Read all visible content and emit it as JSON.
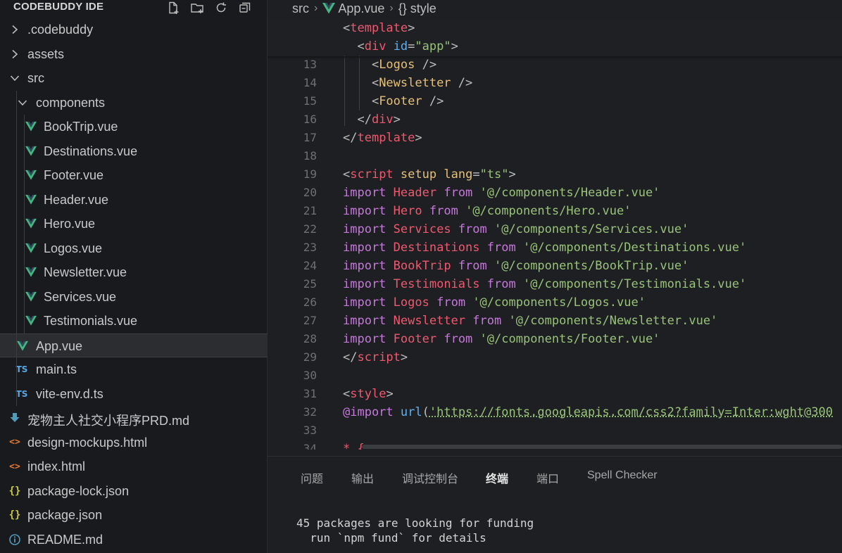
{
  "explorer": {
    "title": "CODEBUDDY IDE",
    "actions": [
      "new-file-icon",
      "new-folder-icon",
      "refresh-icon",
      "collapse-all-icon"
    ],
    "items": [
      {
        "label": ".codebuddy",
        "depth": 0,
        "kind": "folder",
        "open": false,
        "icon": "chevron-right-icon"
      },
      {
        "label": "assets",
        "depth": 0,
        "kind": "folder",
        "open": false,
        "icon": "chevron-right-icon"
      },
      {
        "label": "src",
        "depth": 0,
        "kind": "folder",
        "open": true,
        "icon": "chevron-down-icon"
      },
      {
        "label": "components",
        "depth": 1,
        "kind": "folder",
        "open": true,
        "icon": "chevron-down-icon"
      },
      {
        "label": "BookTrip.vue",
        "depth": 2,
        "kind": "vue",
        "icon": "vue-icon"
      },
      {
        "label": "Destinations.vue",
        "depth": 2,
        "kind": "vue",
        "icon": "vue-icon"
      },
      {
        "label": "Footer.vue",
        "depth": 2,
        "kind": "vue",
        "icon": "vue-icon"
      },
      {
        "label": "Header.vue",
        "depth": 2,
        "kind": "vue",
        "icon": "vue-icon"
      },
      {
        "label": "Hero.vue",
        "depth": 2,
        "kind": "vue",
        "icon": "vue-icon"
      },
      {
        "label": "Logos.vue",
        "depth": 2,
        "kind": "vue",
        "icon": "vue-icon"
      },
      {
        "label": "Newsletter.vue",
        "depth": 2,
        "kind": "vue",
        "icon": "vue-icon"
      },
      {
        "label": "Services.vue",
        "depth": 2,
        "kind": "vue",
        "icon": "vue-icon"
      },
      {
        "label": "Testimonials.vue",
        "depth": 2,
        "kind": "vue",
        "icon": "vue-icon"
      },
      {
        "label": "App.vue",
        "depth": 1,
        "kind": "vue",
        "icon": "vue-icon",
        "selected": true
      },
      {
        "label": "main.ts",
        "depth": 1,
        "kind": "ts",
        "icon": "typescript-icon",
        "icon_text": "TS"
      },
      {
        "label": "vite-env.d.ts",
        "depth": 1,
        "kind": "ts",
        "icon": "typescript-icon",
        "icon_text": "TS"
      },
      {
        "label": "宠物主人社交小程序PRD.md",
        "depth": 0,
        "kind": "md-down",
        "icon": "download-arrow-icon"
      },
      {
        "label": "design-mockups.html",
        "depth": 0,
        "kind": "html",
        "icon": "html-icon",
        "icon_text": "<>"
      },
      {
        "label": "index.html",
        "depth": 0,
        "kind": "html",
        "icon": "html-icon",
        "icon_text": "<>"
      },
      {
        "label": "package-lock.json",
        "depth": 0,
        "kind": "json",
        "icon": "json-icon",
        "icon_text": "{}"
      },
      {
        "label": "package.json",
        "depth": 0,
        "kind": "json",
        "icon": "json-icon",
        "icon_text": "{}"
      },
      {
        "label": "README.md",
        "depth": 0,
        "kind": "info",
        "icon": "info-icon"
      }
    ]
  },
  "breadcrumb": {
    "folder": "src",
    "file": "App.vue",
    "symbol": "{} style"
  },
  "editor": {
    "sticky_lines": [
      [
        [
          "<",
          "punc"
        ],
        [
          "template",
          "tagred"
        ],
        [
          ">",
          "punc"
        ]
      ],
      [
        [
          "  <",
          "punc"
        ],
        [
          "div",
          "tagred"
        ],
        [
          " ",
          ""
        ],
        [
          "id",
          "attr"
        ],
        [
          "=",
          "punc"
        ],
        [
          "\"app\"",
          "str"
        ],
        [
          ">",
          "punc"
        ]
      ]
    ],
    "lines": [
      {
        "n": "13",
        "tokens": [
          [
            "    <",
            "punc"
          ],
          [
            "Logos",
            "tag"
          ],
          [
            " />",
            "punc"
          ]
        ]
      },
      {
        "n": "14",
        "tokens": [
          [
            "    <",
            "punc"
          ],
          [
            "Newsletter",
            "tag"
          ],
          [
            " />",
            "punc"
          ]
        ]
      },
      {
        "n": "15",
        "tokens": [
          [
            "    <",
            "punc"
          ],
          [
            "Footer",
            "tag"
          ],
          [
            " />",
            "punc"
          ]
        ]
      },
      {
        "n": "16",
        "tokens": [
          [
            "  </",
            "punc"
          ],
          [
            "div",
            "tagred"
          ],
          [
            ">",
            "punc"
          ]
        ]
      },
      {
        "n": "17",
        "tokens": [
          [
            "</",
            "punc"
          ],
          [
            "template",
            "tagred"
          ],
          [
            ">",
            "punc"
          ]
        ]
      },
      {
        "n": "18",
        "tokens": []
      },
      {
        "n": "19",
        "tokens": [
          [
            "<",
            "punc"
          ],
          [
            "script",
            "tagred"
          ],
          [
            " ",
            ""
          ],
          [
            "setup",
            "tag"
          ],
          [
            " ",
            ""
          ],
          [
            "lang",
            "tag"
          ],
          [
            "=",
            "punc"
          ],
          [
            "\"ts\"",
            "str"
          ],
          [
            ">",
            "punc"
          ]
        ]
      },
      {
        "n": "20",
        "tokens": [
          [
            "import",
            "kw"
          ],
          [
            " ",
            ""
          ],
          [
            "Header",
            "id"
          ],
          [
            " ",
            ""
          ],
          [
            "from",
            "kw"
          ],
          [
            " ",
            ""
          ],
          [
            "'@/components/Header.vue'",
            "str"
          ]
        ]
      },
      {
        "n": "21",
        "tokens": [
          [
            "import",
            "kw"
          ],
          [
            " ",
            ""
          ],
          [
            "Hero",
            "id"
          ],
          [
            " ",
            ""
          ],
          [
            "from",
            "kw"
          ],
          [
            " ",
            ""
          ],
          [
            "'@/components/Hero.vue'",
            "str"
          ]
        ]
      },
      {
        "n": "22",
        "tokens": [
          [
            "import",
            "kw"
          ],
          [
            " ",
            ""
          ],
          [
            "Services",
            "id"
          ],
          [
            " ",
            ""
          ],
          [
            "from",
            "kw"
          ],
          [
            " ",
            ""
          ],
          [
            "'@/components/Services.vue'",
            "str"
          ]
        ]
      },
      {
        "n": "23",
        "tokens": [
          [
            "import",
            "kw"
          ],
          [
            " ",
            ""
          ],
          [
            "Destinations",
            "id"
          ],
          [
            " ",
            ""
          ],
          [
            "from",
            "kw"
          ],
          [
            " ",
            ""
          ],
          [
            "'@/components/Destinations.vue'",
            "str"
          ]
        ]
      },
      {
        "n": "24",
        "tokens": [
          [
            "import",
            "kw"
          ],
          [
            " ",
            ""
          ],
          [
            "BookTrip",
            "id"
          ],
          [
            " ",
            ""
          ],
          [
            "from",
            "kw"
          ],
          [
            " ",
            ""
          ],
          [
            "'@/components/BookTrip.vue'",
            "str"
          ]
        ]
      },
      {
        "n": "25",
        "tokens": [
          [
            "import",
            "kw"
          ],
          [
            " ",
            ""
          ],
          [
            "Testimonials",
            "id"
          ],
          [
            " ",
            ""
          ],
          [
            "from",
            "kw"
          ],
          [
            " ",
            ""
          ],
          [
            "'@/components/Testimonials.vue'",
            "str"
          ]
        ]
      },
      {
        "n": "26",
        "tokens": [
          [
            "import",
            "kw"
          ],
          [
            " ",
            ""
          ],
          [
            "Logos",
            "id"
          ],
          [
            " ",
            ""
          ],
          [
            "from",
            "kw"
          ],
          [
            " ",
            ""
          ],
          [
            "'@/components/Logos.vue'",
            "str"
          ]
        ]
      },
      {
        "n": "27",
        "tokens": [
          [
            "import",
            "kw"
          ],
          [
            " ",
            ""
          ],
          [
            "Newsletter",
            "id"
          ],
          [
            " ",
            ""
          ],
          [
            "from",
            "kw"
          ],
          [
            " ",
            ""
          ],
          [
            "'@/components/Newsletter.vue'",
            "str"
          ]
        ]
      },
      {
        "n": "28",
        "tokens": [
          [
            "import",
            "kw"
          ],
          [
            " ",
            ""
          ],
          [
            "Footer",
            "id"
          ],
          [
            " ",
            ""
          ],
          [
            "from",
            "kw"
          ],
          [
            " ",
            ""
          ],
          [
            "'@/components/Footer.vue'",
            "str"
          ]
        ]
      },
      {
        "n": "29",
        "tokens": [
          [
            "</",
            "punc"
          ],
          [
            "script",
            "tagred"
          ],
          [
            ">",
            "punc"
          ]
        ]
      },
      {
        "n": "30",
        "tokens": []
      },
      {
        "n": "31",
        "tokens": [
          [
            "<",
            "punc"
          ],
          [
            "style",
            "tagred"
          ],
          [
            ">",
            "punc"
          ]
        ]
      },
      {
        "n": "32",
        "tokens": [
          [
            "@import",
            "kw"
          ],
          [
            " ",
            ""
          ],
          [
            "url",
            "fn"
          ],
          [
            "(",
            "punc"
          ],
          [
            "'https://fonts.googleapis.com/css2?family=Inter:wght@300",
            "url"
          ]
        ]
      },
      {
        "n": "33",
        "tokens": []
      },
      {
        "n": "34",
        "tokens": [
          [
            "* {",
            "tagred"
          ]
        ]
      }
    ]
  },
  "panel": {
    "tabs": [
      {
        "label": "问题",
        "active": false
      },
      {
        "label": "输出",
        "active": false
      },
      {
        "label": "调试控制台",
        "active": false
      },
      {
        "label": "终端",
        "active": true
      },
      {
        "label": "端口",
        "active": false
      },
      {
        "label": "Spell Checker",
        "active": false
      }
    ],
    "terminal_lines": [
      "45 packages are looking for funding",
      "  run `npm fund` for details"
    ]
  },
  "colors": {
    "vue": "#41b883",
    "ts": "#5aa7e0",
    "html": "#e37933",
    "json": "#cbcb41",
    "md": "#519aba",
    "selected_bg": "#2b2d31"
  }
}
